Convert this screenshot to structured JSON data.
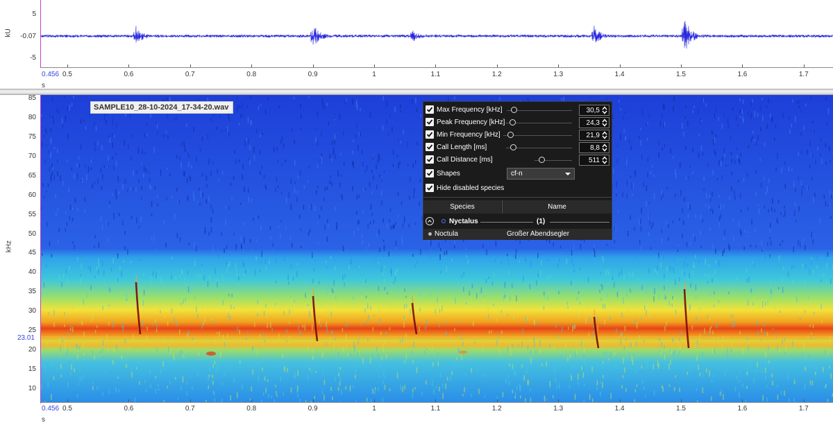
{
  "oscillogram": {
    "unit_label": "kU",
    "y_ticks": [
      "5",
      "-0.07",
      "-5"
    ],
    "x_start_label": "0.456",
    "x_ticks": [
      "0.5",
      "0.6",
      "0.7",
      "0.8",
      "0.9",
      "1",
      "1.1",
      "1.2",
      "1.3",
      "1.4",
      "1.5",
      "1.6",
      "1.7"
    ],
    "x_unit": "s",
    "trace_color": "#2222dd"
  },
  "spectrogram": {
    "file_label": "SAMPLE10_28-10-2024_17-34-20.wav",
    "unit_label": "kHz",
    "y_ticks": [
      "85",
      "80",
      "75",
      "70",
      "65",
      "60",
      "55",
      "50",
      "45",
      "40",
      "35",
      "30",
      "25",
      "20",
      "15",
      "10"
    ],
    "cursor_label": "23.01",
    "x_start_label": "0.456",
    "x_ticks": [
      "0.5",
      "0.6",
      "0.7",
      "0.8",
      "0.9",
      "1",
      "1.1",
      "1.2",
      "1.3",
      "1.4",
      "1.5",
      "1.6",
      "1.7"
    ],
    "x_unit": "s"
  },
  "panel": {
    "params": [
      {
        "label": "Max Frequency [kHz]",
        "value": "30,5",
        "checked": true
      },
      {
        "label": "Peak Frequency [kHz]",
        "value": "24,3",
        "checked": true
      },
      {
        "label": "Min Frequency [kHz]",
        "value": "21,9",
        "checked": true
      },
      {
        "label": "Call Length [ms]",
        "value": "8,8",
        "checked": true
      },
      {
        "label": "Call Distance [ms]",
        "value": "511",
        "checked": true
      }
    ],
    "shapes_label": "Shapes",
    "shapes_value": "cf-n",
    "hide_disabled_label": "Hide disabled species",
    "columns": {
      "species": "Species",
      "name": "Name"
    },
    "group": {
      "name": "Nyctalus",
      "count": "(1)"
    },
    "species": [
      {
        "scientific": "Noctula",
        "common": "Großer Abendsegler"
      }
    ]
  },
  "colors": {
    "axis": "#c040c0",
    "label_blue": "#3344dd",
    "panel_bg": "#1b1b1b"
  }
}
